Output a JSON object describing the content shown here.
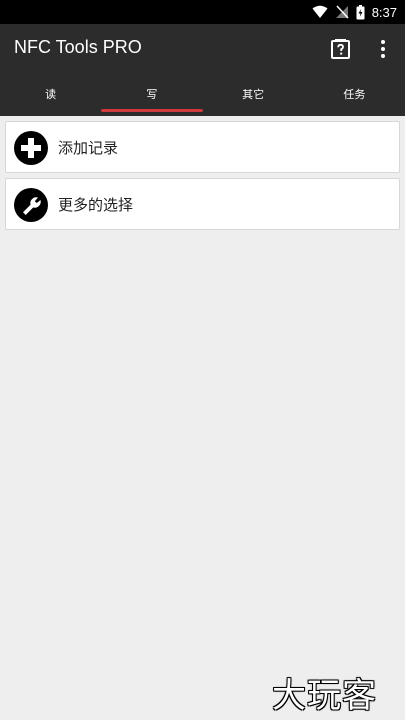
{
  "status_bar": {
    "time": "8:37"
  },
  "app_bar": {
    "title": "NFC Tools PRO"
  },
  "tabs": [
    {
      "label": "读"
    },
    {
      "label": "写"
    },
    {
      "label": "其它"
    },
    {
      "label": "任务"
    }
  ],
  "active_tab": "写",
  "actions": [
    {
      "label": "添加记录",
      "icon": "add-circle-icon"
    },
    {
      "label": "更多的选择",
      "icon": "wrench-icon"
    }
  ],
  "watermark": "大玩客",
  "colors": {
    "app_bar": "#2c2c2c",
    "tab_indicator": "#d03a3a",
    "background": "#eeeeee"
  }
}
